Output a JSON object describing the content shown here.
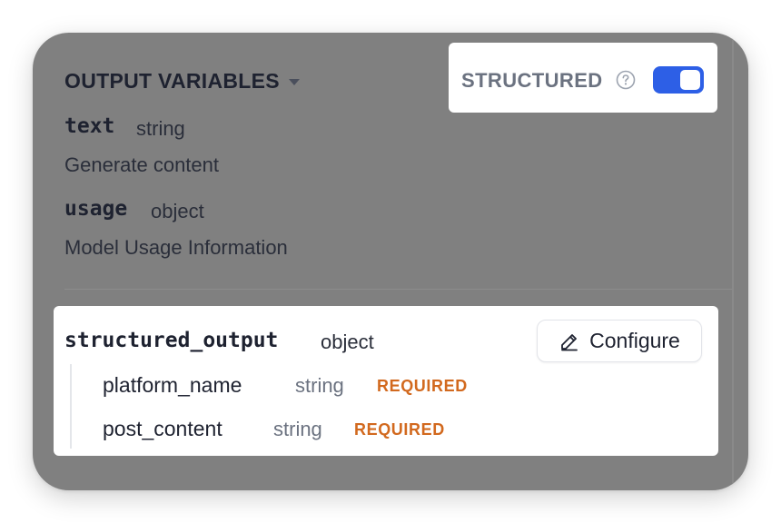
{
  "section": {
    "title": "OUTPUT VARIABLES"
  },
  "variables": [
    {
      "name": "text",
      "type": "string",
      "description": "Generate content"
    },
    {
      "name": "usage",
      "type": "object",
      "description": "Model Usage Information"
    }
  ],
  "structured": {
    "label": "STRUCTURED",
    "enabled": true,
    "accent_color": "#2d5fe6"
  },
  "structured_output": {
    "name": "structured_output",
    "type": "object",
    "configure_label": "Configure",
    "fields": [
      {
        "name": "platform_name",
        "type": "string",
        "required": "REQUIRED"
      },
      {
        "name": "post_content",
        "type": "string",
        "required": "REQUIRED"
      }
    ],
    "required_color": "#d2691e"
  }
}
